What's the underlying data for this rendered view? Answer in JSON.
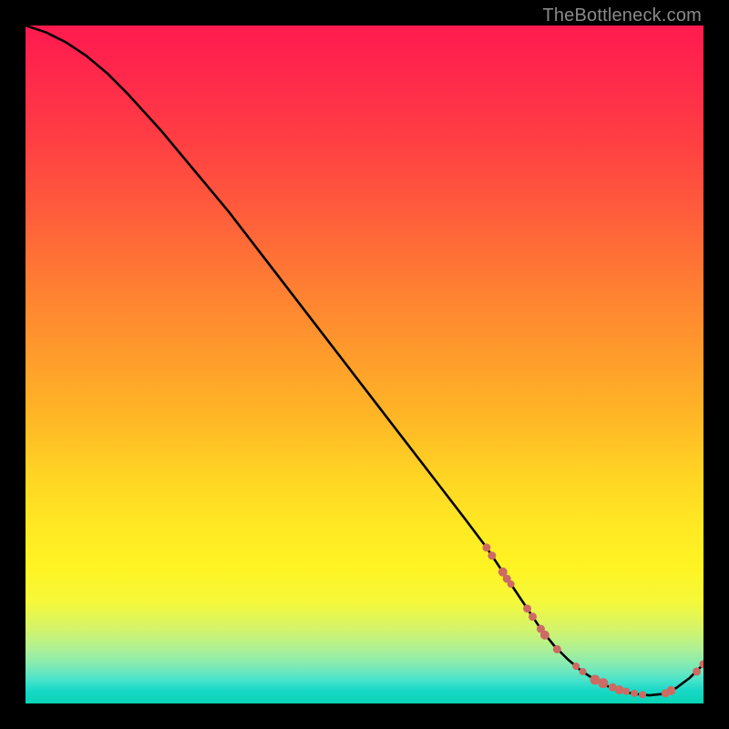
{
  "watermark": "TheBottleneck.com",
  "colors": {
    "background": "#000000",
    "curve": "#000000",
    "scatter": "#cc6b63",
    "gradient_top": "#ff1a4f",
    "gradient_bottom": "#06d3b3"
  },
  "chart_data": {
    "type": "line",
    "title": "",
    "xlabel": "",
    "ylabel": "",
    "xlim": [
      0,
      100
    ],
    "ylim": [
      0,
      100
    ],
    "grid": false,
    "legend": false,
    "series": [
      {
        "name": "curve",
        "kind": "line",
        "x": [
          0,
          3,
          6,
          9,
          12,
          15,
          20,
          25,
          30,
          35,
          40,
          45,
          50,
          55,
          60,
          65,
          68,
          70,
          72,
          74,
          76,
          78,
          80,
          82,
          84,
          86,
          88,
          90,
          92,
          94,
          96,
          98,
          100
        ],
        "y": [
          100,
          99,
          97.5,
          95.5,
          93,
          90,
          84.5,
          78.5,
          72.5,
          66,
          59.5,
          53,
          46.5,
          40,
          33.5,
          27,
          23,
          20,
          17,
          14,
          11,
          8.5,
          6.5,
          4.8,
          3.5,
          2.5,
          1.8,
          1.4,
          1.2,
          1.4,
          2.3,
          3.8,
          5.8
        ]
      },
      {
        "name": "scatter",
        "kind": "scatter",
        "points": [
          {
            "x": 68.0,
            "y": 23.0,
            "r": 4.5
          },
          {
            "x": 68.8,
            "y": 21.8,
            "r": 4.5
          },
          {
            "x": 70.4,
            "y": 19.4,
            "r": 5.0
          },
          {
            "x": 71.0,
            "y": 18.4,
            "r": 4.5
          },
          {
            "x": 71.6,
            "y": 17.6,
            "r": 4.0
          },
          {
            "x": 74.0,
            "y": 14.0,
            "r": 4.5
          },
          {
            "x": 74.8,
            "y": 12.8,
            "r": 4.5
          },
          {
            "x": 76.0,
            "y": 11.0,
            "r": 4.5
          },
          {
            "x": 76.6,
            "y": 10.1,
            "r": 5.0
          },
          {
            "x": 78.4,
            "y": 8.0,
            "r": 4.5
          },
          {
            "x": 81.2,
            "y": 5.5,
            "r": 4.0
          },
          {
            "x": 82.2,
            "y": 4.7,
            "r": 4.0
          },
          {
            "x": 84.0,
            "y": 3.5,
            "r": 5.5
          },
          {
            "x": 85.2,
            "y": 3.0,
            "r": 5.5
          },
          {
            "x": 86.6,
            "y": 2.4,
            "r": 4.5
          },
          {
            "x": 87.6,
            "y": 2.0,
            "r": 5.0
          },
          {
            "x": 88.6,
            "y": 1.8,
            "r": 4.0
          },
          {
            "x": 89.8,
            "y": 1.5,
            "r": 4.0
          },
          {
            "x": 91.0,
            "y": 1.3,
            "r": 4.0
          },
          {
            "x": 94.4,
            "y": 1.5,
            "r": 4.5
          },
          {
            "x": 95.2,
            "y": 1.9,
            "r": 5.0
          },
          {
            "x": 99.0,
            "y": 4.7,
            "r": 4.5
          },
          {
            "x": 100.0,
            "y": 5.8,
            "r": 4.5
          }
        ]
      }
    ]
  }
}
